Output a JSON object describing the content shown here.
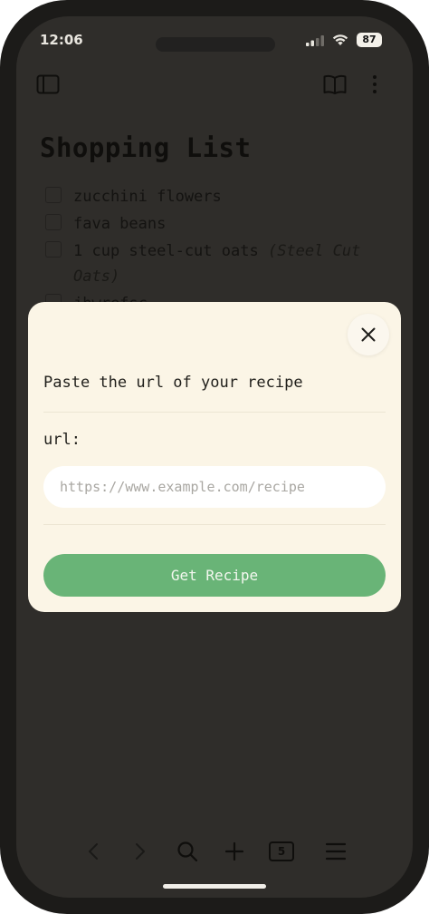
{
  "status_bar": {
    "time": "12:06",
    "battery": "87"
  },
  "toolbar": {
    "sidebar_icon": "sidebar-toggle-icon",
    "reader_icon": "book-open-icon",
    "more_icon": "more-vertical-icon"
  },
  "list": {
    "title": "Shopping List",
    "items": [
      {
        "text": "zucchini flowers",
        "note": ""
      },
      {
        "text": "fava beans",
        "note": ""
      },
      {
        "text": "1 cup steel-cut oats",
        "note": "(Steel Cut Oats)"
      },
      {
        "text": "jhwrefsc",
        "note": ""
      }
    ]
  },
  "modal": {
    "heading": "Paste the url of your recipe",
    "url_label": "url:",
    "url_value": "",
    "url_placeholder": "https://www.example.com/recipe",
    "submit_label": "Get Recipe",
    "close_icon": "close-icon",
    "accent_color": "#69b477",
    "background_color": "#fbf5e6"
  },
  "bottom_bar": {
    "tab_count": "5",
    "icons": [
      "back-icon",
      "forward-icon",
      "search-icon",
      "plus-icon",
      "tabs-icon",
      "menu-icon"
    ]
  }
}
